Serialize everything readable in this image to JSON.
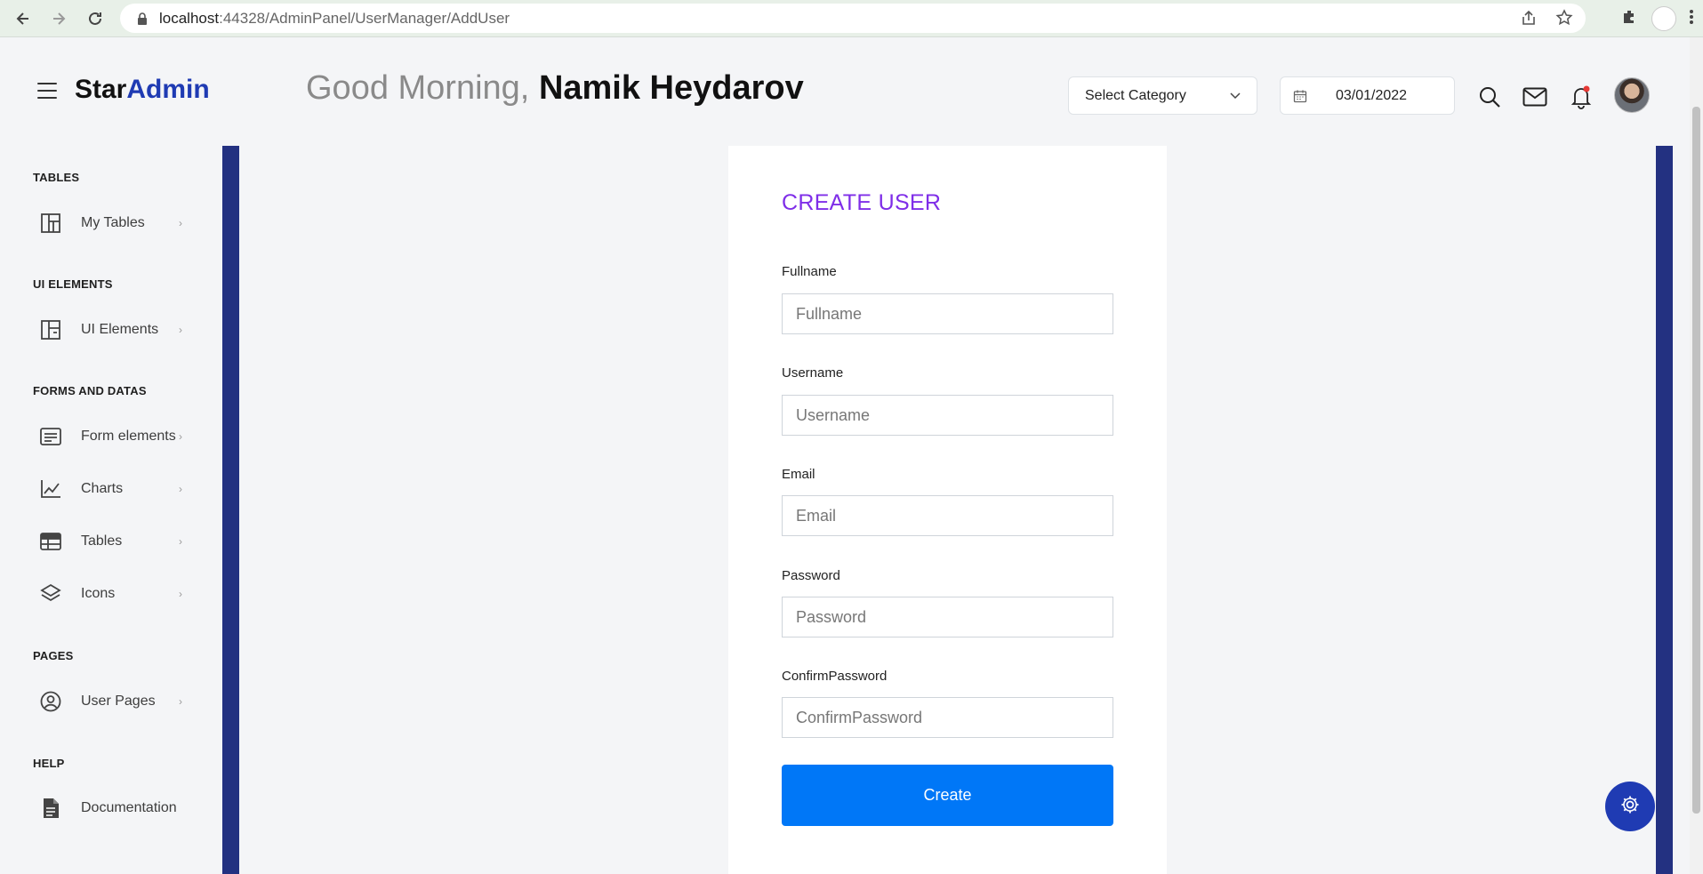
{
  "browser": {
    "url_host": "localhost",
    "url_rest": ":44328/AdminPanel/UserManager/AddUser",
    "profile_text": "Profile"
  },
  "header": {
    "brand_part1": "Star",
    "brand_part2": "Admin",
    "greeting": "Good Morning,",
    "user_name": "Namik Heydarov",
    "category_select": "Select Category",
    "date": "03/01/2022"
  },
  "sidebar": {
    "sections": [
      {
        "title": "TABLES",
        "items": [
          {
            "label": "My Tables",
            "icon": "table-layout-icon"
          }
        ]
      },
      {
        "title": "UI ELEMENTS",
        "items": [
          {
            "label": "UI Elements",
            "icon": "layout-icon"
          }
        ]
      },
      {
        "title": "FORMS AND DATAS",
        "items": [
          {
            "label": "Form elements",
            "icon": "form-icon"
          },
          {
            "label": "Charts",
            "icon": "chart-line-icon"
          },
          {
            "label": "Tables",
            "icon": "table-icon"
          },
          {
            "label": "Icons",
            "icon": "layers-icon"
          }
        ]
      },
      {
        "title": "PAGES",
        "items": [
          {
            "label": "User Pages",
            "icon": "user-circle-icon"
          }
        ]
      },
      {
        "title": "HELP",
        "items": [
          {
            "label": "Documentation",
            "icon": "document-icon"
          }
        ]
      }
    ]
  },
  "form": {
    "title": "CREATE USER",
    "fields": [
      {
        "label": "Fullname",
        "placeholder": "Fullname",
        "value": ""
      },
      {
        "label": "Username",
        "placeholder": "Username",
        "value": ""
      },
      {
        "label": "Email",
        "placeholder": "Email",
        "value": ""
      },
      {
        "label": "Password",
        "placeholder": "Password",
        "value": ""
      },
      {
        "label": "ConfirmPassword",
        "placeholder": "ConfirmPassword",
        "value": ""
      }
    ],
    "submit_label": "Create"
  },
  "colors": {
    "brand_blue": "#1f3bb3",
    "sidebar_stripe": "#233181",
    "title_purple": "#7f2ee8",
    "button_blue": "#0077f7"
  }
}
